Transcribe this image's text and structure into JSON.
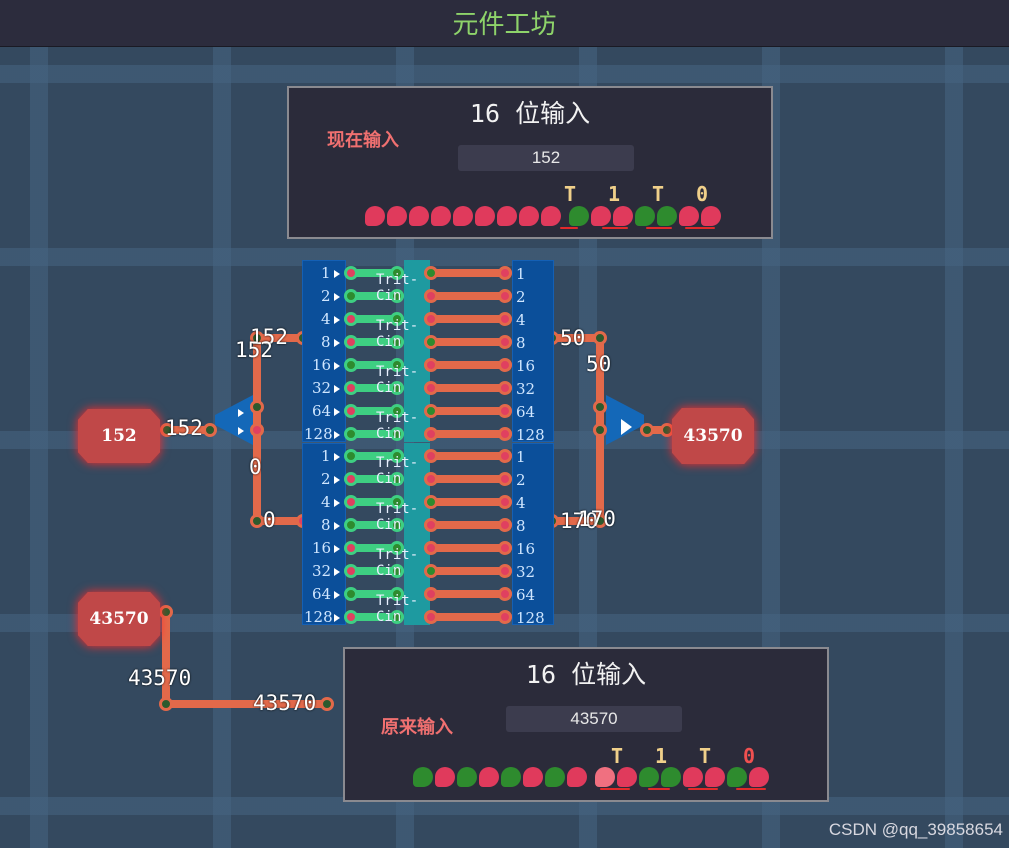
{
  "header": {
    "title": "元件工坊"
  },
  "top_panel": {
    "title": "16 位输入",
    "subtitle": "现在输入",
    "value": "152",
    "trit_labels": [
      "T",
      "1",
      "T",
      "0"
    ],
    "trits": [
      "r",
      "r",
      "r",
      "r",
      "r",
      "r",
      "r",
      "r",
      "r",
      "g",
      "r",
      "r",
      "g",
      "g",
      "r",
      "r"
    ]
  },
  "bottom_panel": {
    "title": "16 位输入",
    "subtitle": "原来输入",
    "value": "43570",
    "trit_labels": [
      "T",
      "1",
      "T",
      "0"
    ],
    "trits": [
      "g",
      "r",
      "g",
      "r",
      "g",
      "r",
      "g",
      "r",
      "p",
      "r",
      "g",
      "g",
      "r",
      "r",
      "g",
      "r"
    ]
  },
  "nodes": {
    "input_now": "152",
    "output": "43570",
    "input_orig": "43570"
  },
  "wire_labels": {
    "in_main": "152",
    "split_top_a": "152",
    "split_top_b": "152",
    "split_bottom_a": "0",
    "split_bottom_b": "0",
    "out_top_a": "50",
    "out_top_b": "50",
    "out_bottom_a": "170",
    "out_bottom_b": "170",
    "orig_a": "43570",
    "orig_b": "43570"
  },
  "component": {
    "name": "Trit-Cin",
    "bits": [
      "1",
      "2",
      "4",
      "8",
      "16",
      "32",
      "64",
      "128"
    ]
  },
  "colors": {
    "wire": "#e2694a",
    "accent": "#8ed36a",
    "node": "#c04848",
    "component": "#0b4f9a"
  },
  "watermark": "CSDN @qq_39858654"
}
